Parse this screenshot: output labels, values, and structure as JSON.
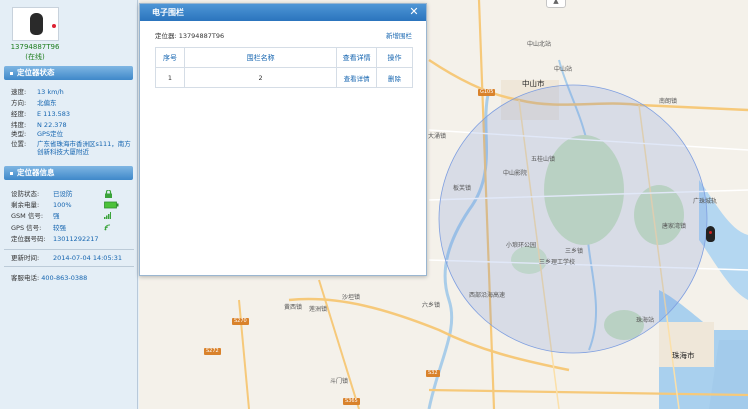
{
  "device": {
    "name": "13794887T96",
    "online": "(在线)"
  },
  "status_section": {
    "title": "定位器状态",
    "rows": [
      {
        "label": "速度:",
        "value": "13 km/h"
      },
      {
        "label": "方向:",
        "value": "北偏东"
      },
      {
        "label": "经度:",
        "value": "E 113.583"
      },
      {
        "label": "纬度:",
        "value": "N 22.378"
      },
      {
        "label": "类型:",
        "value": "GPS定位"
      },
      {
        "label": "位置:",
        "value": "广东省珠海市香洲区s111，南方创新科技大厦附近"
      }
    ]
  },
  "info_section": {
    "title": "定位器信息",
    "rows": [
      {
        "label": "设防状态:",
        "value": "已设防"
      },
      {
        "label": "剩余电量:",
        "value": "100%"
      },
      {
        "label": "GSM 信号:",
        "value": "强"
      },
      {
        "label": "GPS 信号:",
        "value": "较强"
      },
      {
        "label": "定位器号码:",
        "value": "13011292217"
      }
    ]
  },
  "update": {
    "label": "更新时间:",
    "value": "2014-07-04 14:05:31"
  },
  "service": {
    "label": "客服电话: ",
    "value": "400-863-0388"
  },
  "dialog": {
    "title": "电子围栏",
    "device_label": "定位器: ",
    "device_value": "13794887T96",
    "new_label": "新增围栏",
    "table": {
      "headers": [
        "序号",
        "围栏名称",
        "查看详情",
        "操作"
      ],
      "rows": [
        {
          "index": "1",
          "name": "2",
          "view": "查看详情",
          "action": "删除"
        }
      ]
    }
  },
  "map": {
    "labels": [
      "中山市",
      "中山北站",
      "中山站",
      "南朗镇",
      "大涌镇",
      "五桂山镇",
      "板芙镇",
      "中山影院",
      "小琅环公园",
      "三乡镇",
      "三乡理工学校",
      "唐家湾镇",
      "广珠城轨",
      "六乡镇",
      "沙坦镇",
      "黄西镇",
      "斗门镇",
      "珠海站",
      "珠海市",
      "西部沿海高速",
      "莲洲镇"
    ],
    "roads": [
      "G105",
      "S270",
      "S272",
      "S32",
      "S365"
    ]
  }
}
